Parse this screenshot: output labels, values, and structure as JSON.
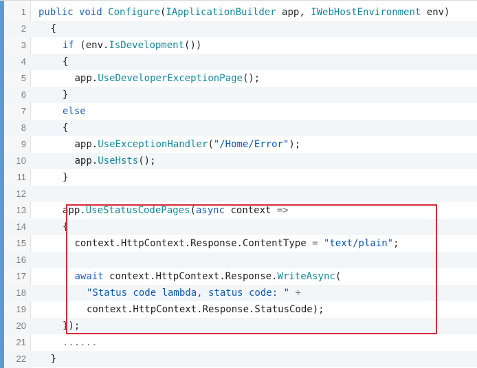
{
  "code": {
    "lines": [
      {
        "n": "1",
        "indent": 0,
        "tokens": [
          {
            "t": "public void ",
            "c": "kw"
          },
          {
            "t": "Configure",
            "c": "fn"
          },
          {
            "t": "(",
            "c": ""
          },
          {
            "t": "IApplicationBuilder",
            "c": "ty"
          },
          {
            "t": " app, ",
            "c": ""
          },
          {
            "t": "IWebHostEnvironment",
            "c": "ty"
          },
          {
            "t": " env)",
            "c": ""
          }
        ]
      },
      {
        "n": "2",
        "indent": 1,
        "tokens": [
          {
            "t": "{",
            "c": ""
          }
        ]
      },
      {
        "n": "3",
        "indent": 2,
        "tokens": [
          {
            "t": "if",
            "c": "kw"
          },
          {
            "t": " (env.",
            "c": ""
          },
          {
            "t": "IsDevelopment",
            "c": "fn"
          },
          {
            "t": "())",
            "c": ""
          }
        ]
      },
      {
        "n": "4",
        "indent": 2,
        "tokens": [
          {
            "t": "{",
            "c": ""
          }
        ]
      },
      {
        "n": "5",
        "indent": 3,
        "tokens": [
          {
            "t": "app.",
            "c": ""
          },
          {
            "t": "UseDeveloperExceptionPage",
            "c": "fn"
          },
          {
            "t": "();",
            "c": ""
          }
        ]
      },
      {
        "n": "6",
        "indent": 2,
        "tokens": [
          {
            "t": "}",
            "c": ""
          }
        ]
      },
      {
        "n": "7",
        "indent": 2,
        "tokens": [
          {
            "t": "else",
            "c": "kw"
          }
        ]
      },
      {
        "n": "8",
        "indent": 2,
        "tokens": [
          {
            "t": "{",
            "c": ""
          }
        ]
      },
      {
        "n": "9",
        "indent": 3,
        "tokens": [
          {
            "t": "app.",
            "c": ""
          },
          {
            "t": "UseExceptionHandler",
            "c": "fn"
          },
          {
            "t": "(",
            "c": ""
          },
          {
            "t": "\"/Home/Error\"",
            "c": "str"
          },
          {
            "t": ");",
            "c": ""
          }
        ]
      },
      {
        "n": "10",
        "indent": 3,
        "tokens": [
          {
            "t": "app.",
            "c": ""
          },
          {
            "t": "UseHsts",
            "c": "fn"
          },
          {
            "t": "();",
            "c": ""
          }
        ]
      },
      {
        "n": "11",
        "indent": 2,
        "tokens": [
          {
            "t": "}",
            "c": ""
          }
        ]
      },
      {
        "n": "12",
        "indent": 0,
        "tokens": []
      },
      {
        "n": "13",
        "indent": 2,
        "tokens": [
          {
            "t": "app.",
            "c": ""
          },
          {
            "t": "UseStatusCodePages",
            "c": "fn"
          },
          {
            "t": "(",
            "c": ""
          },
          {
            "t": "async",
            "c": "kw"
          },
          {
            "t": " context ",
            "c": ""
          },
          {
            "t": "=>",
            "c": "op"
          }
        ]
      },
      {
        "n": "14",
        "indent": 2,
        "tokens": [
          {
            "t": "{",
            "c": ""
          }
        ]
      },
      {
        "n": "15",
        "indent": 3,
        "tokens": [
          {
            "t": "context.HttpContext.Response.ContentType ",
            "c": ""
          },
          {
            "t": "=",
            "c": "op"
          },
          {
            "t": " ",
            "c": ""
          },
          {
            "t": "\"text/plain\"",
            "c": "str"
          },
          {
            "t": ";",
            "c": ""
          }
        ]
      },
      {
        "n": "16",
        "indent": 0,
        "tokens": []
      },
      {
        "n": "17",
        "indent": 3,
        "tokens": [
          {
            "t": "await",
            "c": "kw"
          },
          {
            "t": " context.HttpContext.Response.",
            "c": ""
          },
          {
            "t": "WriteAsync",
            "c": "fn"
          },
          {
            "t": "(",
            "c": ""
          }
        ]
      },
      {
        "n": "18",
        "indent": 4,
        "tokens": [
          {
            "t": "\"Status code lambda, status code: \"",
            "c": "str"
          },
          {
            "t": " ",
            "c": ""
          },
          {
            "t": "+",
            "c": "op"
          }
        ]
      },
      {
        "n": "19",
        "indent": 4,
        "tokens": [
          {
            "t": "context.HttpContext.Response.StatusCode);",
            "c": ""
          }
        ]
      },
      {
        "n": "20",
        "indent": 2,
        "tokens": [
          {
            "t": "});",
            "c": ""
          }
        ]
      },
      {
        "n": "21",
        "indent": 2,
        "tokens": [
          {
            "t": "......",
            "c": "op"
          }
        ]
      },
      {
        "n": "22",
        "indent": 1,
        "tokens": [
          {
            "t": "}",
            "c": ""
          }
        ]
      }
    ]
  },
  "colors": {
    "keyword": "#1f5fbf",
    "method": "#11899c",
    "string": "#0b57b4",
    "highlight_border": "#d62b3c",
    "accent_bar": "#5b9bd5"
  }
}
